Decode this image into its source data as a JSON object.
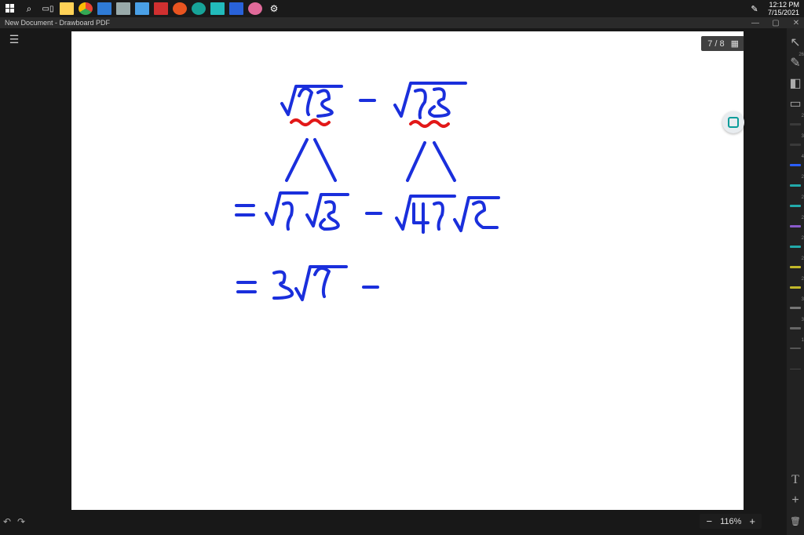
{
  "system": {
    "time": "12:12 PM",
    "date": "7/15/2021"
  },
  "taskbar_apps": [
    {
      "name": "start",
      "color": "#ffffff"
    },
    {
      "name": "search",
      "glyph": "⌕"
    },
    {
      "name": "task-view",
      "glyph": "⧉"
    },
    {
      "name": "file-explorer",
      "color": "#ffd257"
    },
    {
      "name": "chrome",
      "color": "#ff5b44"
    },
    {
      "name": "outlook",
      "color": "#2f7bd6"
    },
    {
      "name": "app-grey",
      "color": "#9aa"
    },
    {
      "name": "app-blue",
      "color": "#4aa0e6"
    },
    {
      "name": "adobe",
      "color": "#d03030"
    },
    {
      "name": "ubuntu",
      "color": "#e95420"
    },
    {
      "name": "drawboard",
      "color": "#17a398"
    },
    {
      "name": "app-teal",
      "color": "#2bb"
    },
    {
      "name": "mail",
      "color": "#2962d9"
    },
    {
      "name": "paint",
      "color": "#e06a9a"
    },
    {
      "name": "settings",
      "glyph": "⚙"
    }
  ],
  "window": {
    "title": "New Document - Drawboard PDF"
  },
  "page_counter": {
    "current": 7,
    "total": 8,
    "display": "7 / 8"
  },
  "zoom": {
    "level": "116%"
  },
  "right_tools": [
    {
      "name": "cursor-tool",
      "glyph": "↖"
    },
    {
      "name": "pen-count",
      "glyph": "✎",
      "badge": "26"
    },
    {
      "name": "eraser-tool",
      "glyph": "◧"
    },
    {
      "name": "shape-tool",
      "glyph": "◇"
    },
    {
      "name": "pen-dark-1",
      "color": "#3a3a3a",
      "badge": "2"
    },
    {
      "name": "pen-dark-2",
      "color": "#3a3a3a",
      "badge": "3"
    },
    {
      "name": "pen-blue",
      "color": "#2b5fff",
      "badge": "4"
    },
    {
      "name": "pen-teal-1",
      "color": "#2aa",
      "badge": "2"
    },
    {
      "name": "pen-teal-2",
      "color": "#2aa",
      "badge": "2"
    },
    {
      "name": "pen-purple",
      "color": "#8a5acb",
      "badge": "2"
    },
    {
      "name": "pen-teal-3",
      "color": "#2aa",
      "badge": "2"
    },
    {
      "name": "pen-yellow-1",
      "color": "#c2b82a",
      "badge": "2"
    },
    {
      "name": "pen-yellow-2",
      "color": "#c2b82a",
      "badge": "2"
    },
    {
      "name": "pen-grey-1",
      "color": "#777",
      "badge": "3"
    },
    {
      "name": "pen-grey-2",
      "color": "#666",
      "badge": "3"
    },
    {
      "name": "pen-small",
      "color": "#555",
      "badge": "1"
    },
    {
      "name": "divider-tool",
      "color": "#444"
    }
  ],
  "right_tools_bottom": [
    {
      "name": "text-tool",
      "glyph": "T"
    },
    {
      "name": "add-tool",
      "glyph": "+"
    },
    {
      "name": "trash-tool",
      "glyph": "🗑"
    }
  ],
  "math": {
    "line1": {
      "expr1": "√72",
      "op": "−",
      "expr2": "√98"
    },
    "line2": {
      "eq": "=",
      "a": "√9 √8",
      "op": "−",
      "b": "√49 √2"
    },
    "line3": {
      "eq": "=",
      "a": "3√7",
      "op": "−"
    },
    "ink_color": "#1a2fdc",
    "underline_color": "#e21818"
  }
}
